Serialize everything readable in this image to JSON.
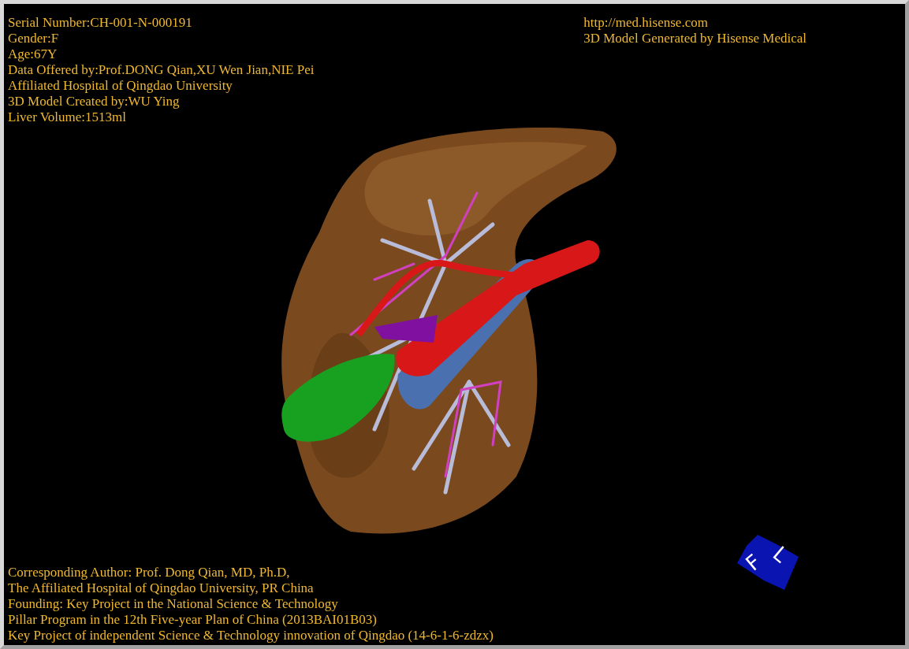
{
  "patient_info": [
    "Serial Number:CH-001-N-000191",
    "Gender:F",
    "Age:67Y",
    "Data Offered by:Prof.DONG Qian,XU Wen Jian,NIE Pei",
    "Affiliated Hospital of Qingdao University",
    "3D Model Created by:WU Ying",
    "Liver Volume:1513ml"
  ],
  "source_info": [
    "http://med.hisense.com",
    "3D Model Generated by Hisense Medical"
  ],
  "credits": [
    "Corresponding Author: Prof. Dong Qian, MD, Ph.D,",
    "The Affiliated Hospital of Qingdao University, PR China",
    "Founding: Key Project in the National Science & Technology",
    "Pillar Program in the 12th Five-year Plan of China (2013BAI01B03)",
    "Key Project of independent Science & Technology innovation of Qingdao (14-6-1-6-zdzx)"
  ],
  "orientation_cube": {
    "faces": [
      "F",
      "L"
    ]
  }
}
